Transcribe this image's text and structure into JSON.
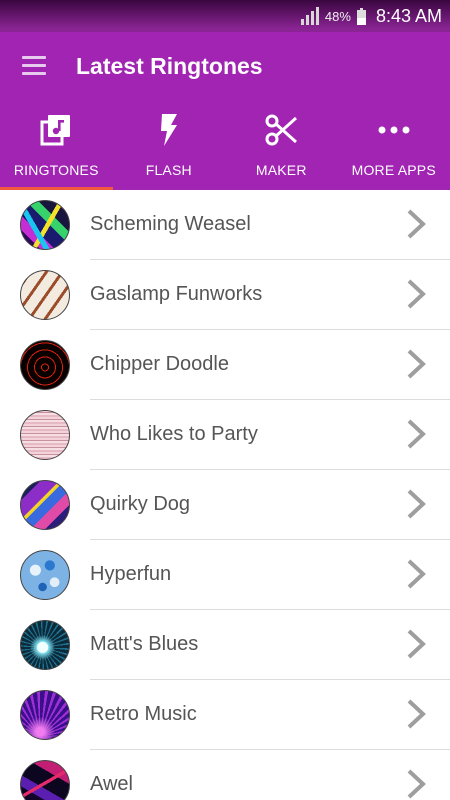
{
  "status_bar": {
    "battery_percent": "48%",
    "battery_level": 0.48,
    "time": "8:43 AM",
    "signal_bars": 4
  },
  "toolbar": {
    "menu_icon": "hamburger-menu-icon",
    "title": "Latest Ringtones"
  },
  "tabs": [
    {
      "label": "RINGTONES",
      "icon": "music-library-icon",
      "active": true
    },
    {
      "label": "FLASH",
      "icon": "flash-icon",
      "active": false
    },
    {
      "label": "MAKER",
      "icon": "scissors-icon",
      "active": false
    },
    {
      "label": "MORE APPS",
      "icon": "more-horizontal-icon",
      "active": false
    }
  ],
  "ringtones": [
    {
      "title": "Scheming Weasel",
      "thumb": "rainbow-streaks"
    },
    {
      "title": "Gaslamp Funworks",
      "thumb": "brown-stripes"
    },
    {
      "title": "Chipper Doodle",
      "thumb": "red-swirl"
    },
    {
      "title": "Who Likes to Party",
      "thumb": "pink-fabric"
    },
    {
      "title": "Quirky Dog",
      "thumb": "blue-purple-streaks"
    },
    {
      "title": "Hyperfun",
      "thumb": "blue-marble"
    },
    {
      "title": "Matt's Blues",
      "thumb": "teal-spiral"
    },
    {
      "title": "Retro Music",
      "thumb": "purple-rays"
    },
    {
      "title": "Awel",
      "thumb": "magenta-lines"
    }
  ],
  "colors": {
    "primary": "#a124b3",
    "status_bar_top": "#3a063f",
    "tab_indicator": "#f15a3e",
    "row_text": "#555555",
    "chevron": "#9e9e9e",
    "divider": "#dddddd"
  }
}
